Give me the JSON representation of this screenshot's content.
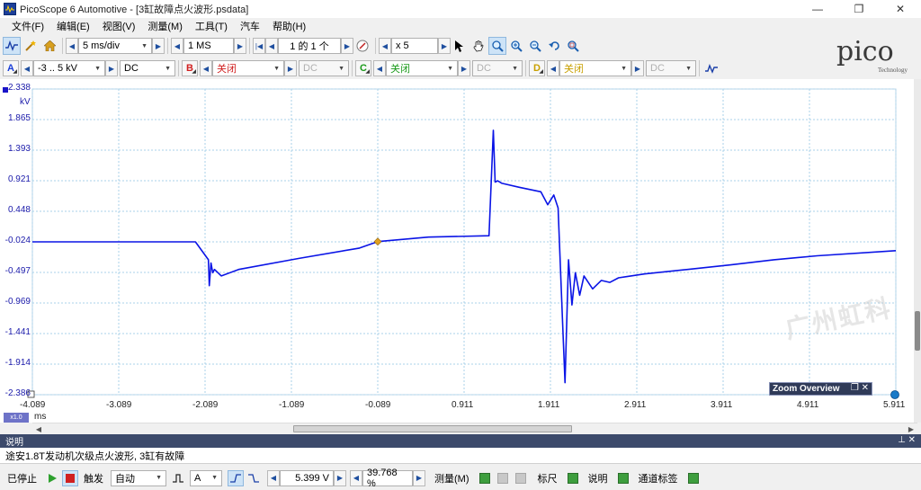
{
  "window": {
    "title": "PicoScope 6 Automotive - [3缸故障点火波形.psdata]"
  },
  "menu": [
    "文件(F)",
    "编辑(E)",
    "视图(V)",
    "测量(M)",
    "工具(T)",
    "汽车",
    "帮助(H)"
  ],
  "toolbar": {
    "timebase": "5 ms/div",
    "samples": "1 MS",
    "buffer": "1 的 1 个",
    "zoom": "x 5"
  },
  "channels": {
    "a": {
      "tag": "A",
      "range": "-3 .. 5 kV",
      "coupling": "DC"
    },
    "b": {
      "tag": "B",
      "range": "关闭",
      "coupling": "DC"
    },
    "c": {
      "tag": "C",
      "range": "关闭",
      "coupling": "DC"
    },
    "d": {
      "tag": "D",
      "range": "关闭",
      "coupling": "DC"
    }
  },
  "logo": {
    "word": "pico",
    "tagline": "Technology"
  },
  "scope": {
    "y_unit": "kV",
    "x_unit": "ms",
    "zoom_tag": "x1.0",
    "y_ticks": [
      "2.338",
      "1.865",
      "1.393",
      "0.921",
      "0.448",
      "-0.024",
      "-0.497",
      "-0.969",
      "-1.441",
      "-1.914",
      "-2.386"
    ],
    "x_ticks": [
      "-4.089",
      "-3.089",
      "-2.089",
      "-1.089",
      "-0.089",
      "0.911",
      "1.911",
      "2.911",
      "3.911",
      "4.911",
      "5.911"
    ],
    "zoom_overview": "Zoom Overview",
    "watermark": "广州虹科"
  },
  "chart_data": {
    "type": "line",
    "title": "",
    "xlabel": "ms",
    "ylabel": "kV",
    "xlim": [
      -4.089,
      5.911
    ],
    "ylim": [
      -2.386,
      2.338
    ],
    "grid": true,
    "series": [
      {
        "color": "#0a14e6",
        "x": [
          -4.089,
          -2.2,
          -2.05,
          -2.04,
          -2.02,
          -2.0,
          -1.98,
          -1.9,
          -1.7,
          -1.0,
          -0.3,
          -0.089,
          0.5,
          1.2,
          1.25,
          1.27,
          1.3,
          1.35,
          1.55,
          1.8,
          1.88,
          1.95,
          2.0,
          2.05,
          2.08,
          2.12,
          2.16,
          2.2,
          2.25,
          2.3,
          2.4,
          2.5,
          2.6,
          2.7,
          2.8,
          3.0,
          3.5,
          4.0,
          4.5,
          5.0,
          5.911
        ],
        "y": [
          -0.024,
          -0.024,
          -0.3,
          -0.7,
          -0.35,
          -0.5,
          -0.45,
          -0.55,
          -0.45,
          -0.28,
          -0.12,
          -0.02,
          0.05,
          0.07,
          1.7,
          0.9,
          0.92,
          0.88,
          0.82,
          0.75,
          0.55,
          0.7,
          0.5,
          -1.2,
          -2.2,
          -0.3,
          -1.0,
          -0.5,
          -0.85,
          -0.55,
          -0.75,
          -0.62,
          -0.65,
          -0.58,
          -0.56,
          -0.52,
          -0.45,
          -0.38,
          -0.3,
          -0.24,
          -0.16
        ]
      }
    ],
    "markers": [
      {
        "x": -0.089,
        "y": -0.02,
        "color": "#e0a020"
      }
    ]
  },
  "notes": {
    "header": "说明",
    "text": "途安1.8T发动机次级点火波形, 3缸有故障"
  },
  "status": {
    "state": "已停止",
    "trigger_label": "触发",
    "trigger_mode": "自动",
    "trigger_channel": "A",
    "trigger_level": "5.399 V",
    "trigger_pre": "39.768 %",
    "measure": "测量(M)",
    "ruler": "标尺",
    "notes": "说明",
    "channel_labels": "通道标签"
  }
}
